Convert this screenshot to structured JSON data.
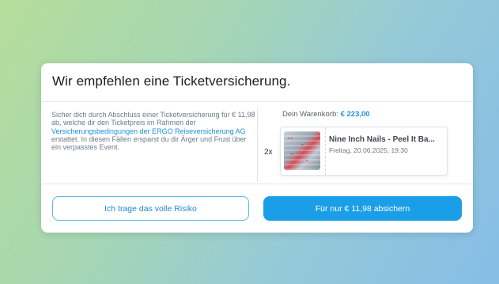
{
  "modal": {
    "title": "Wir empfehlen eine Ticketversicherung.",
    "description": {
      "part1": "Sicher dich durch Abschluss einer Ticketversicherung für € 11,98 ab, welche dir den Ticketpreis im Rahmen der ",
      "link": "Versicherungsbedingungen der ERGO Reiseversicherung AG",
      "part2": " erstattet. In diesen Fällen ersparst du dir Ärger und Frust über ein verpasstes Event."
    },
    "cart": {
      "label": "Dein Warenkorb: ",
      "total": "€ 223,00",
      "quantity": "2x",
      "event_name": "Nine Inch Nails - Peel It Ba...",
      "event_date": "Freitag, 20.06.2025, 19:30"
    },
    "buttons": {
      "decline": "Ich trage das volle Risiko",
      "accept": "Für nur € 11,98 absichern"
    }
  },
  "colors": {
    "accent": "#1b9ee8",
    "link": "#1e8fdc",
    "price": "#1e93e0"
  },
  "icons": {
    "ticket_image": "event-ticket-thumbnail"
  }
}
